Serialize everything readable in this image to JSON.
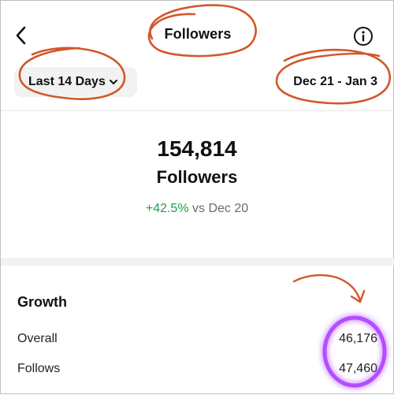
{
  "header": {
    "title": "Followers",
    "back_icon": "chevron-left-icon",
    "info_icon": "info-circle-icon"
  },
  "filters": {
    "range_label": "Last 14 Days",
    "range_icon": "chevron-down-icon",
    "date_range": "Dec 21 - Jan 3"
  },
  "summary": {
    "value": "154,814",
    "label": "Followers",
    "change_pct": "+42.5%",
    "change_compare": "vs Dec 20"
  },
  "growth": {
    "title": "Growth",
    "rows": [
      {
        "label": "Overall",
        "value": "46,176"
      },
      {
        "label": "Follows",
        "value": "47,460"
      }
    ]
  },
  "colors": {
    "positive": "#1f9e4a",
    "annotation_orange": "#d2572b",
    "annotation_glow": "#b44dff",
    "divider": "#e6e6e6",
    "control_bg": "#f2f2f2"
  }
}
